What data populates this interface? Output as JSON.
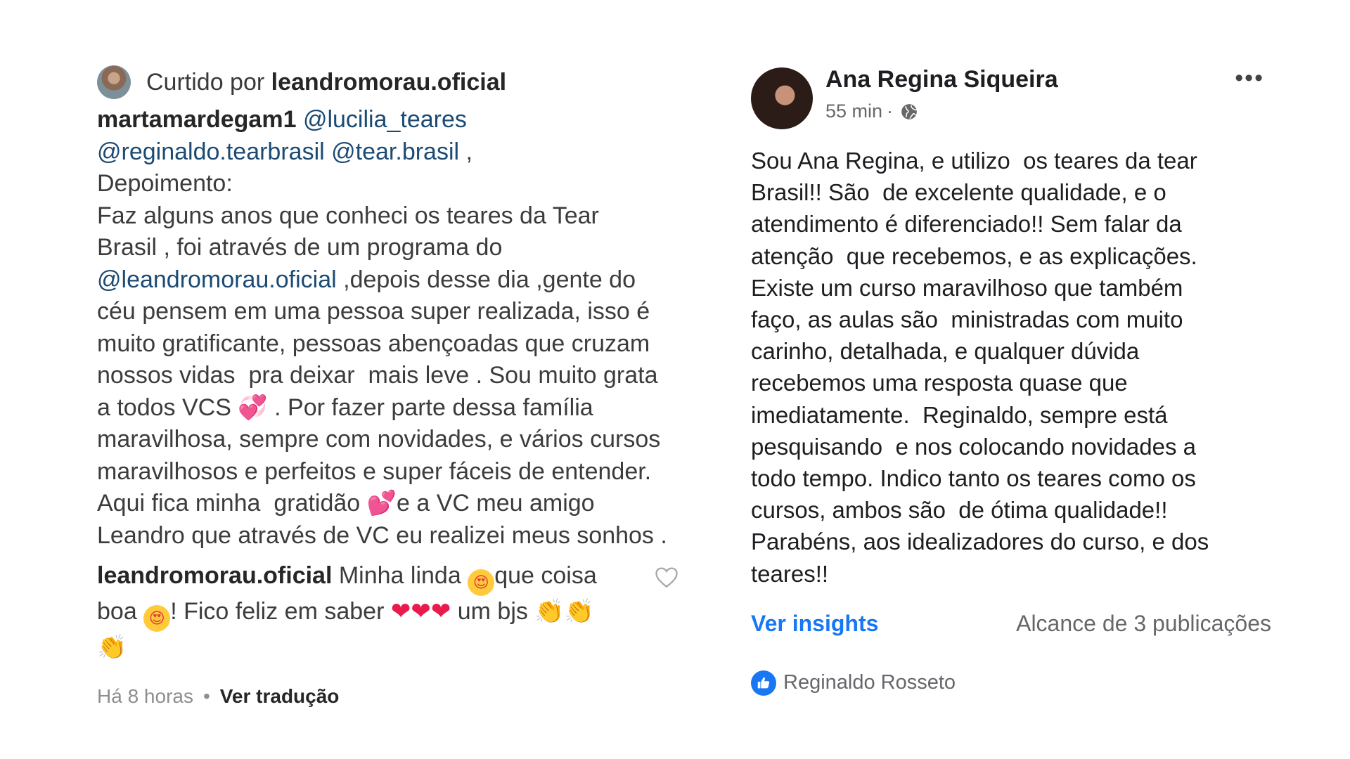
{
  "instagram": {
    "liked_by_prefix": "Curtido por ",
    "liked_by_user": "leandromorau.oficial",
    "comment": {
      "username": "martamardegam1",
      "mention_1": "@lucilia_teares",
      "mention_2": "@reginaldo.tearbrasil",
      "mention_3": "@tear.brasil",
      "after_mentions": " ,",
      "line_depoimento": "Depoimento:",
      "line_a": "Faz alguns anos que conheci os teares da Tear",
      "line_b": "Brasil , foi através de um programa do",
      "mention_4": "@leandromorau.oficial",
      "line_c": " ,depois desse dia ,gente do",
      "line_d": "céu pensem em uma pessoa super realizada, isso é",
      "line_e": "muito gratificante, pessoas abençoadas que cruzam",
      "line_f": "nossos vidas  pra deixar  mais leve . Sou muito grata",
      "line_g1": "a todos VCS ",
      "heart_1": "💞",
      "line_g2": " . Por fazer parte dessa família",
      "line_h": "maravilhosa, sempre com novidades, e vários cursos",
      "line_i": "maravilhosos e perfeitos e super fáceis de entender.",
      "line_j1": "Aqui fica minha  gratidão ",
      "heart_2": "💕",
      "line_j2": "e a VC meu amigo",
      "line_k": "Leandro que através de VC eu realizei meus sonhos ."
    },
    "reply": {
      "username": "leandromorau.oficial",
      "text_1": " Minha linda ",
      "face": "😍",
      "text_2": "que coisa",
      "text_3": "boa ",
      "text_4": "! Fico feliz em saber ",
      "hearts": "❤❤❤",
      "text_5": " um bjs ",
      "claps": "👏👏",
      "clap_last": "👏"
    },
    "time": "Há 8 horas",
    "separator": "•",
    "translate": "Ver tradução"
  },
  "facebook": {
    "author": "Ana Regina Siqueira",
    "time": "55 min",
    "separator": "·",
    "more": "•••",
    "body": "Sou Ana Regina, e utilizo  os teares da tear\nBrasil!! São  de excelente qualidade, e o\natendimento é diferenciado!! Sem falar da\natenção  que recebemos, e as explicações.\nExiste um curso maravilhoso que também\nfaço, as aulas são  ministradas com muito\ncarinho, detalhada, e qualquer dúvida\nrecebemos uma resposta quase que\nimediatamente.  Reginaldo, sempre está\npesquisando  e nos colocando novidades a\ntodo tempo. Indico tanto os teares como os\ncursos, ambos são  de ótima qualidade!!\nParabéns, aos idealizadores do curso, e dos\nteares!!",
    "insights_label": "Ver insights",
    "reach": "Alcance de 3 publicações",
    "reaction_user": "Reginaldo Rosseto"
  }
}
